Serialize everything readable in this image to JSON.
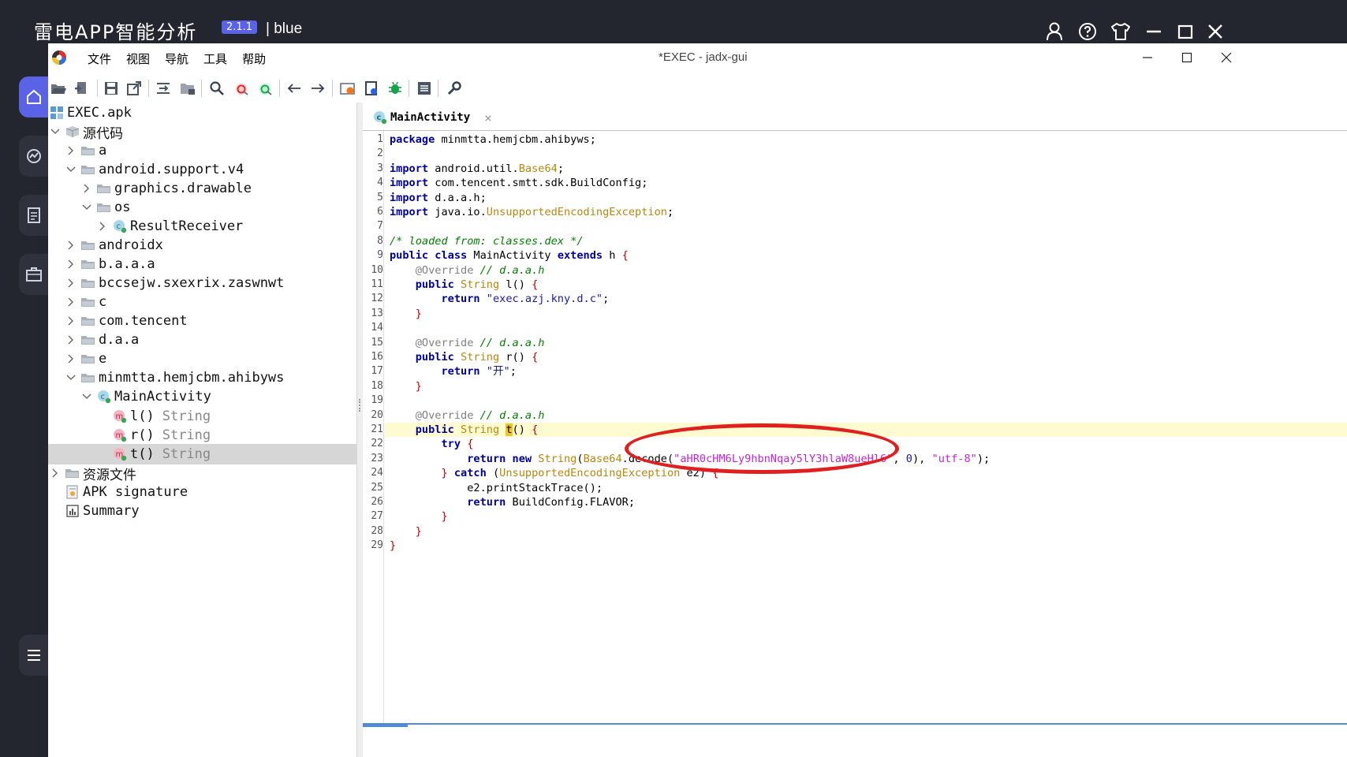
{
  "outer": {
    "app_title": "雷电APP智能分析",
    "version": "2.1.1",
    "user": "| blue"
  },
  "window": {
    "title": "*EXEC - jadx-gui",
    "menu": [
      "文件",
      "视图",
      "导航",
      "工具",
      "帮助"
    ]
  },
  "tree": {
    "rows": [
      {
        "label": "EXEC.apk",
        "type": ""
      },
      {
        "label": "源代码",
        "type": ""
      },
      {
        "label": "a",
        "type": ""
      },
      {
        "label": "android.support.v4",
        "type": ""
      },
      {
        "label": "graphics.drawable",
        "type": ""
      },
      {
        "label": "os",
        "type": ""
      },
      {
        "label": "ResultReceiver",
        "type": ""
      },
      {
        "label": "androidx",
        "type": ""
      },
      {
        "label": "b.a.a.a",
        "type": ""
      },
      {
        "label": "bccsejw.sxexrix.zaswnwt",
        "type": ""
      },
      {
        "label": "c",
        "type": ""
      },
      {
        "label": "com.tencent",
        "type": ""
      },
      {
        "label": "d.a.a",
        "type": ""
      },
      {
        "label": "e",
        "type": ""
      },
      {
        "label": "minmtta.hemjcbm.ahibyws",
        "type": ""
      },
      {
        "label": "MainActivity",
        "type": ""
      },
      {
        "label": "l()",
        "type": "String"
      },
      {
        "label": "r()",
        "type": "String"
      },
      {
        "label": "t()",
        "type": "String"
      },
      {
        "label": "资源文件",
        "type": ""
      },
      {
        "label": "APK signature",
        "type": ""
      },
      {
        "label": "Summary",
        "type": ""
      }
    ]
  },
  "editor": {
    "tab_label": "MainActivity",
    "line_numbers": [
      "1",
      "2",
      "3",
      "4",
      "5",
      "6",
      "7",
      "8",
      "9",
      "10",
      "11",
      "12",
      "13",
      "14",
      "15",
      "16",
      "17",
      "18",
      "19",
      "20",
      "21",
      "22",
      "23",
      "24",
      "25",
      "26",
      "27",
      "28",
      "29"
    ],
    "code": {
      "l1_pkg": "minmtta.hemjcbm.ahibyws;",
      "l3": "android.util.",
      "l3t": "Base64",
      "l4": "com.tencent.smtt.sdk.BuildConfig;",
      "l5": "d.a.a.h;",
      "l6": "java.io.",
      "l6t": "UnsupportedEncodingException",
      "l8": "/* loaded from: classes.dex */",
      "l9": "MainActivity",
      "l9b": "h",
      "override": "@Override",
      "cmt_daah": "// d.a.a.h",
      "m_l": "l",
      "m_r": "r",
      "m_t": "t",
      "ret_l": "\"exec.azj.kny.d.c\"",
      "ret_r": "\"开\"",
      "b64_str": "\"aHR0cHM6Ly9hbnNqay5lY3hlaW8ueHl6\"",
      "zero": "0",
      "utf8": "\"utf-8\"",
      "print_stack": "e2.printStackTrace();",
      "flavor": "BuildConfig.FLAVOR;"
    }
  }
}
